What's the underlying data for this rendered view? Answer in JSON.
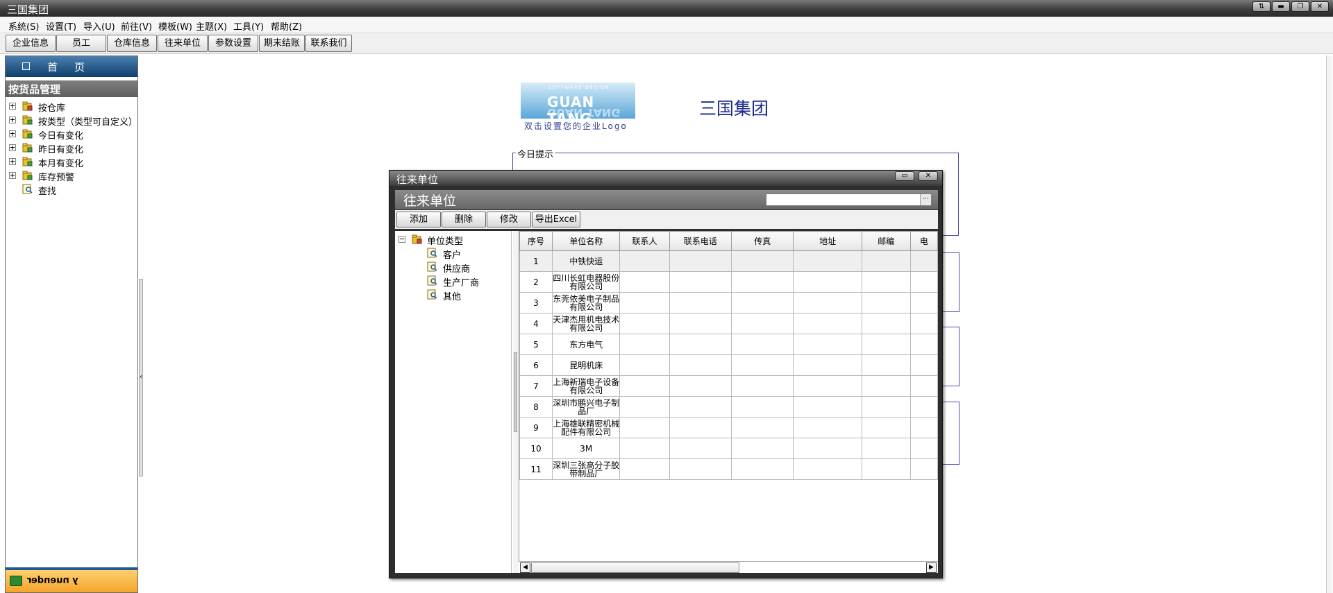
{
  "window": {
    "title": "三国集团"
  },
  "menu": [
    "系统(S)",
    "设置(T)",
    "导入(U)",
    "前往(V)",
    "模板(W)",
    "主题(X)",
    "工具(Y)",
    "帮助(Z)"
  ],
  "toolbar": [
    "企业信息",
    "员工",
    "仓库信息",
    "往来单位",
    "参数设置",
    "期末结账",
    "联系我们"
  ],
  "sidebar": {
    "home_tab": "首页",
    "section": "按货品管理",
    "tree": [
      "按仓库",
      "按类型（类型可自定义）",
      "今日有变化",
      "昨日有变化",
      "本月有变化",
      "库存预警",
      "查找"
    ],
    "bottom_label": "ɹǝpuǝnu ʎ"
  },
  "logo": {
    "tagline": "SOFTWARE DESIGN",
    "brand": "GUAN TANG",
    "hint": "双击设置您的企业Logo"
  },
  "company_name": "三国集团",
  "today_panel": {
    "legend": "今日提示"
  },
  "dialog": {
    "title": "往来单位",
    "header": "往来单位",
    "search_value": "",
    "buttons": [
      "添加",
      "删除",
      "修改",
      "导出Excel"
    ],
    "tree_root": "单位类型",
    "tree_children": [
      "客户",
      "供应商",
      "生产厂商",
      "其他"
    ],
    "columns": [
      "序号",
      "单位名称",
      "联系人",
      "联系电话",
      "传真",
      "地址",
      "邮编",
      "电"
    ],
    "rows": [
      [
        "1",
        "中铁快运"
      ],
      [
        "2",
        "四川长虹电器股份有限公司"
      ],
      [
        "3",
        "东莞依美电子制品有限公司"
      ],
      [
        "4",
        "天津杰用机电技术有限公司"
      ],
      [
        "5",
        "东方电气"
      ],
      [
        "6",
        "昆明机床"
      ],
      [
        "7",
        "上海新瑞电子设备有限公司"
      ],
      [
        "8",
        "深圳市鹏兴电子制品厂"
      ],
      [
        "9",
        "上海雄联精密机械配件有限公司"
      ],
      [
        "10",
        "3M"
      ],
      [
        "11",
        "深圳三张高分子胶带制品厂"
      ]
    ]
  },
  "colors": {
    "accent": "#1c2a8c",
    "title_bar": "#3c3c3c",
    "sidebar_tab": "#0f3f6c"
  }
}
